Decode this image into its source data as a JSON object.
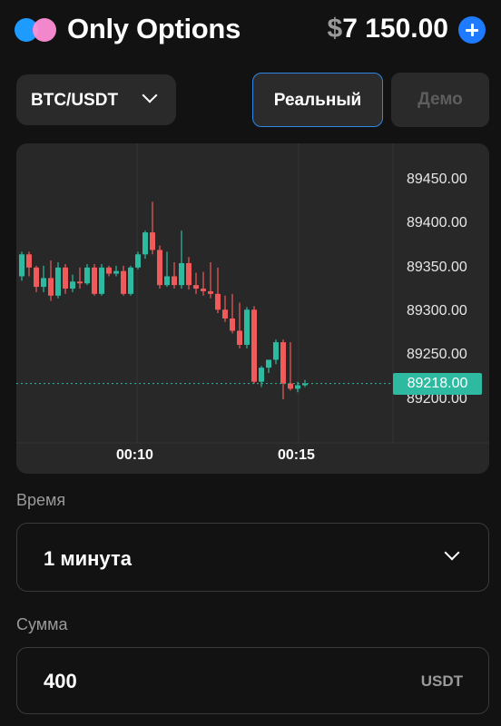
{
  "header": {
    "app_title": "Only Options",
    "balance_currency": "$",
    "balance_amount": "7 150.00",
    "add_icon": "plus-circle-icon"
  },
  "pair_selector": {
    "label": "BTC/USDT",
    "icon": "chevron-down-icon"
  },
  "account_mode": {
    "real_label": "Реальный",
    "demo_label": "Демо",
    "selected": "Реальный"
  },
  "chart_data": {
    "type": "candlestick",
    "title": "",
    "xlabel": "",
    "ylabel": "",
    "ylim": [
      89175,
      89485
    ],
    "x_ticks": [
      "00:10",
      "00:15"
    ],
    "y_ticks": [
      "89450.00",
      "89400.00",
      "89350.00",
      "89300.00",
      "89250.00",
      "89200.00"
    ],
    "current_price": "89218.00",
    "colors": {
      "up": "#2dbaa0",
      "down": "#ef5b5b",
      "grid": "#343434",
      "price_line": "#2dbaa0"
    },
    "candles": [
      {
        "o": 89340,
        "h": 89368,
        "c": 89365,
        "l": 89335
      },
      {
        "o": 89365,
        "h": 89368,
        "c": 89350,
        "l": 89340
      },
      {
        "o": 89350,
        "h": 89352,
        "c": 89328,
        "l": 89322
      },
      {
        "o": 89328,
        "h": 89352,
        "c": 89338,
        "l": 89322
      },
      {
        "o": 89338,
        "h": 89358,
        "c": 89318,
        "l": 89312
      },
      {
        "o": 89318,
        "h": 89356,
        "c": 89350,
        "l": 89315
      },
      {
        "o": 89350,
        "h": 89354,
        "c": 89326,
        "l": 89320
      },
      {
        "o": 89326,
        "h": 89342,
        "c": 89334,
        "l": 89322
      },
      {
        "o": 89334,
        "h": 89350,
        "c": 89332,
        "l": 89326
      },
      {
        "o": 89332,
        "h": 89354,
        "c": 89350,
        "l": 89330
      },
      {
        "o": 89350,
        "h": 89354,
        "c": 89320,
        "l": 89318
      },
      {
        "o": 89320,
        "h": 89354,
        "c": 89350,
        "l": 89318
      },
      {
        "o": 89350,
        "h": 89352,
        "c": 89343,
        "l": 89340
      },
      {
        "o": 89343,
        "h": 89352,
        "c": 89346,
        "l": 89340
      },
      {
        "o": 89346,
        "h": 89352,
        "c": 89320,
        "l": 89318
      },
      {
        "o": 89320,
        "h": 89352,
        "c": 89350,
        "l": 89318
      },
      {
        "o": 89350,
        "h": 89368,
        "c": 89365,
        "l": 89348
      },
      {
        "o": 89365,
        "h": 89392,
        "c": 89390,
        "l": 89360
      },
      {
        "o": 89390,
        "h": 89425,
        "c": 89370,
        "l": 89365
      },
      {
        "o": 89370,
        "h": 89375,
        "c": 89330,
        "l": 89326
      },
      {
        "o": 89330,
        "h": 89368,
        "c": 89340,
        "l": 89328
      },
      {
        "o": 89340,
        "h": 89356,
        "c": 89330,
        "l": 89326
      },
      {
        "o": 89330,
        "h": 89392,
        "c": 89355,
        "l": 89326
      },
      {
        "o": 89355,
        "h": 89362,
        "c": 89330,
        "l": 89325
      },
      {
        "o": 89330,
        "h": 89344,
        "c": 89326,
        "l": 89320
      },
      {
        "o": 89326,
        "h": 89345,
        "c": 89323,
        "l": 89318
      },
      {
        "o": 89323,
        "h": 89356,
        "c": 89320,
        "l": 89315
      },
      {
        "o": 89320,
        "h": 89350,
        "c": 89302,
        "l": 89298
      },
      {
        "o": 89302,
        "h": 89318,
        "c": 89292,
        "l": 89288
      },
      {
        "o": 89292,
        "h": 89320,
        "c": 89278,
        "l": 89275
      },
      {
        "o": 89278,
        "h": 89310,
        "c": 89262,
        "l": 89258
      },
      {
        "o": 89262,
        "h": 89305,
        "c": 89302,
        "l": 89258
      },
      {
        "o": 89302,
        "h": 89306,
        "c": 89220,
        "l": 89218
      },
      {
        "o": 89220,
        "h": 89238,
        "c": 89236,
        "l": 89214
      },
      {
        "o": 89236,
        "h": 89242,
        "c": 89245,
        "l": 89230
      },
      {
        "o": 89245,
        "h": 89268,
        "c": 89265,
        "l": 89240
      },
      {
        "o": 89265,
        "h": 89268,
        "c": 89218,
        "l": 89200
      },
      {
        "o": 89218,
        "h": 89265,
        "c": 89212,
        "l": 89210
      },
      {
        "o": 89212,
        "h": 89220,
        "c": 89216,
        "l": 89208
      },
      {
        "o": 89216,
        "h": 89222,
        "c": 89218,
        "l": 89214
      }
    ]
  },
  "time_field": {
    "label": "Время",
    "value": "1 минута",
    "icon": "chevron-down-icon"
  },
  "amount_field": {
    "label": "Сумма",
    "value": "400",
    "unit": "USDT"
  }
}
